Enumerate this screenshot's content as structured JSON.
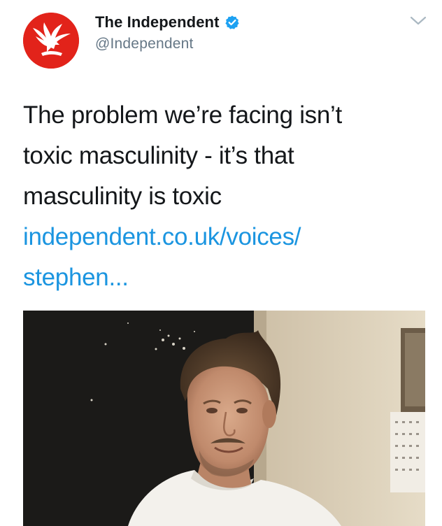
{
  "tweet": {
    "author": {
      "display_name": "The Independent",
      "handle": "@Independent",
      "verified": true,
      "avatar_icon": "eagle-logo-icon",
      "avatar_color": "#e2231a"
    },
    "text_lines": [
      "The problem we’re facing isn’t",
      "toxic masculinity - it’s that",
      "masculinity is toxic"
    ],
    "link_lines": [
      "independent.co.uk/voices/",
      "stephen..."
    ],
    "link_color": "#1b95e0",
    "verified_color": "#1da1f2",
    "menu_icon": "chevron-down-icon",
    "media_icon": "photo-icon"
  }
}
